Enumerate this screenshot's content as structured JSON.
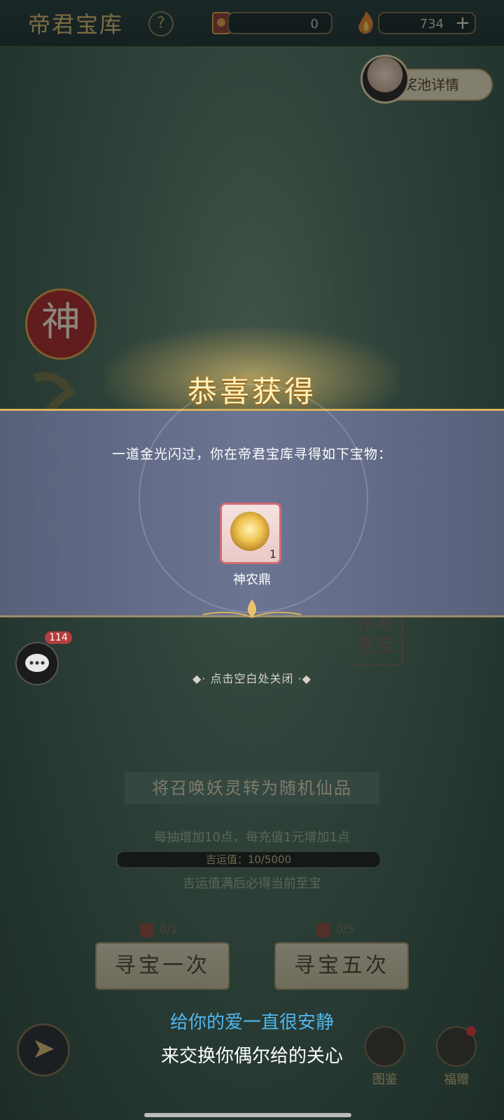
{
  "header": {
    "title": "帝君宝库",
    "help_icon": "question-icon",
    "ticket_count": "0",
    "currency_count": "734",
    "add_label": "+"
  },
  "pool_button": {
    "label": "奖池详情"
  },
  "side": {
    "badge": "神",
    "chat_count": "114"
  },
  "seal_text": "帝君至宝",
  "main": {
    "banner": "将召唤妖灵转为随机仙品",
    "rule": "每抽增加10点，每充值1元增加1点",
    "luck_label": "吉运值：10/5000",
    "luck_progress": 0.002,
    "guarantee": "吉运值满后必得当前至宝",
    "single_cost": "0/1",
    "five_cost": "0/5",
    "single_button": "寻宝一次",
    "five_button": "寻宝五次"
  },
  "lyrics": {
    "line1": "给你的爱一直很安静",
    "line2": "来交换你偶尔给的关心"
  },
  "bottom_nav": {
    "back_icon": "back-arrow-icon",
    "atlas_label": "图鉴",
    "gift_label": "福赠"
  },
  "popup": {
    "title": "恭喜获得",
    "message": "一道金光闪过，你在帝君宝库寻得如下宝物：",
    "item_name": "神农鼎",
    "item_qty": "1",
    "close_hint": "◆· 点击空白处关闭 ·◆"
  },
  "colors": {
    "accent_gold": "#d9b66a",
    "popup_border": "#cf6a73",
    "lyric_blue": "#4fb6ee"
  }
}
